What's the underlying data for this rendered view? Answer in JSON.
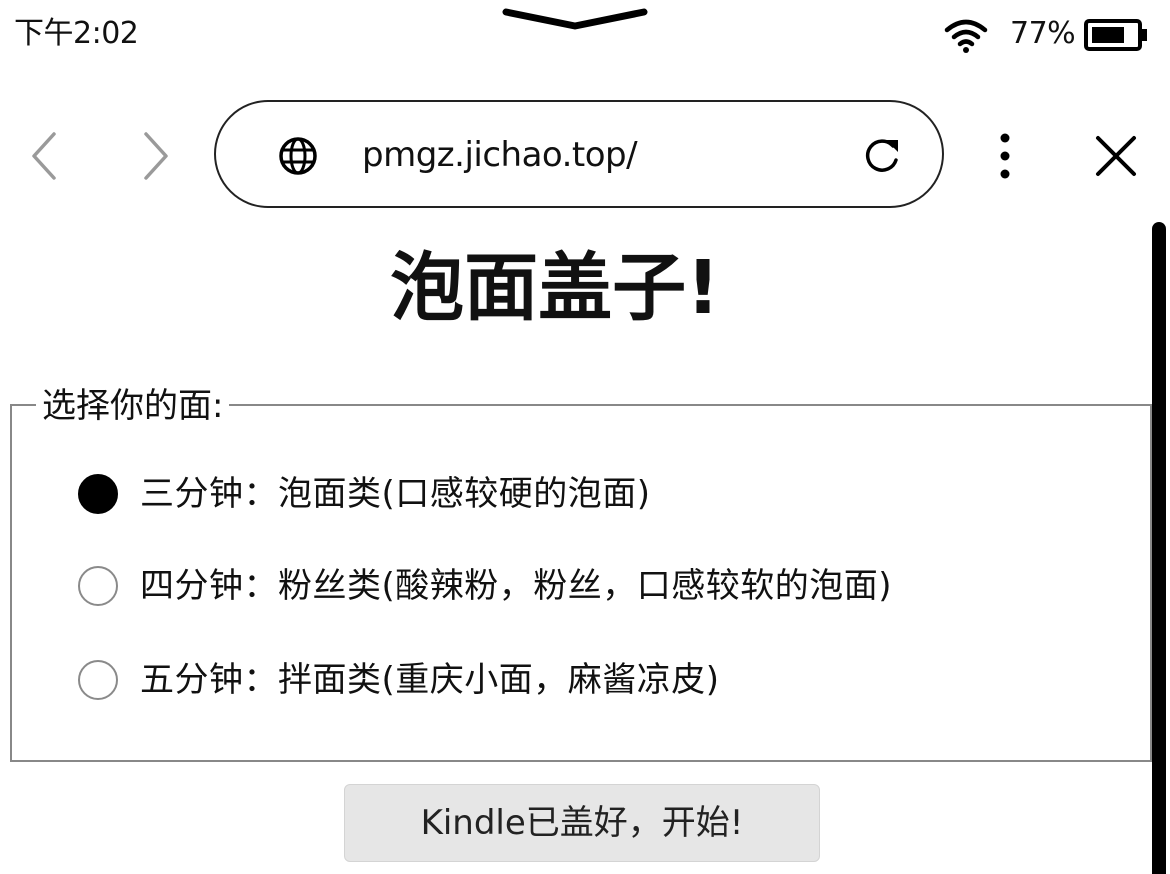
{
  "status_bar": {
    "time": "下午2:02",
    "battery_percent": "77%",
    "battery_level": 0.77,
    "icons": [
      "pull-down-handle-icon",
      "wifi-icon",
      "battery-icon"
    ]
  },
  "browser": {
    "url": "pmgz.jichao.top/",
    "icons": [
      "back-icon",
      "forward-icon",
      "globe-icon",
      "reload-icon",
      "more-menu-icon",
      "close-icon"
    ]
  },
  "page": {
    "title": "泡面盖子!",
    "fieldset_legend": "选择你的面:",
    "options": [
      {
        "label": "三分钟：泡面类(口感较硬的泡面)",
        "checked": true
      },
      {
        "label": "四分钟：粉丝类(酸辣粉，粉丝，口感较软的泡面)",
        "checked": false
      },
      {
        "label": "五分钟：拌面类(重庆小面，麻酱凉皮)",
        "checked": false
      }
    ],
    "start_button_label": "Kindle已盖好，开始!"
  },
  "colors": {
    "foreground": "#111111",
    "button_background": "#e6e6e6",
    "border_gray": "#888888"
  }
}
